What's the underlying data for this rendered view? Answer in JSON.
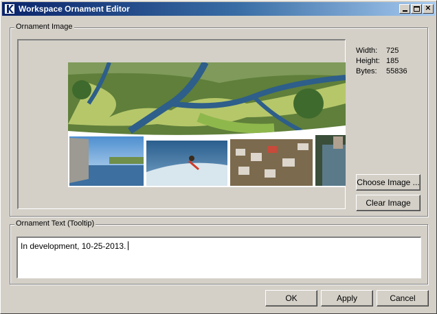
{
  "window": {
    "title": "Workspace Ornament Editor",
    "app_icon": "app-logo-icon",
    "controls": {
      "minimize": "minimize-icon",
      "maximize": "maximize-icon",
      "close": "close-icon",
      "close_glyph": "✕"
    }
  },
  "image_group": {
    "legend": "Ornament Image",
    "info": {
      "width_label": "Width:",
      "width_value": "725",
      "height_label": "Height:",
      "height_value": "185",
      "bytes_label": "Bytes:",
      "bytes_value": "55836"
    },
    "choose_button": "Choose Image ...",
    "clear_button": "Clear Image"
  },
  "text_group": {
    "legend": "Ornament Text (Tooltip)",
    "value": "In development, 10-25-2013."
  },
  "buttons": {
    "ok": "OK",
    "apply": "Apply",
    "cancel": "Cancel"
  },
  "colors": {
    "dialog_bg": "#d4d0c8",
    "title_gradient_start": "#0a246a",
    "title_gradient_end": "#a6caf0"
  }
}
